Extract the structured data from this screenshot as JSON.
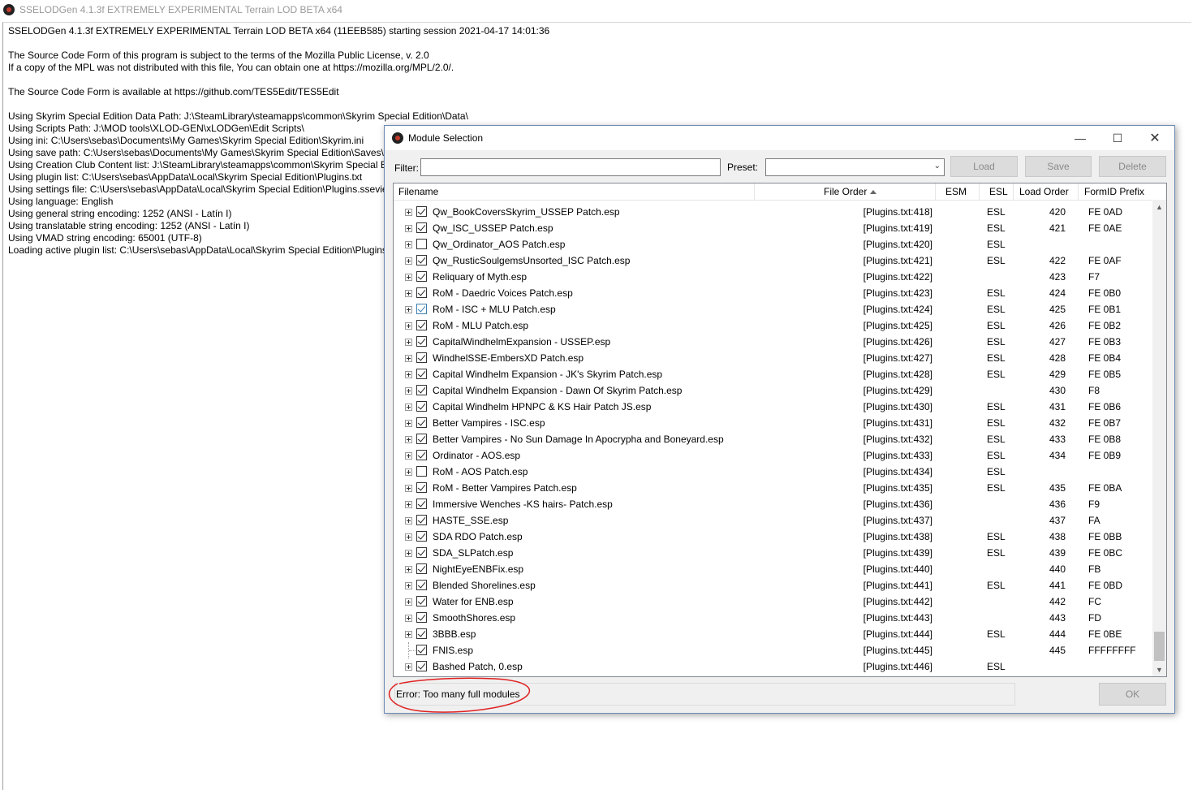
{
  "main": {
    "title": "SSELODGen 4.1.3f EXTREMELY EXPERIMENTAL Terrain LOD BETA x64",
    "log": [
      "SSELODGen 4.1.3f EXTREMELY EXPERIMENTAL Terrain LOD BETA x64 (11EEB585) starting session 2021-04-17 14:01:36",
      "",
      "The Source Code Form of this program is subject to the terms of the Mozilla Public License, v. 2.0",
      "If a copy of the MPL was not distributed with this file, You can obtain one at https://mozilla.org/MPL/2.0/.",
      "",
      "The Source Code Form is available at https://github.com/TES5Edit/TES5Edit",
      "",
      "Using Skyrim Special Edition Data Path: J:\\SteamLibrary\\steamapps\\common\\Skyrim Special Edition\\Data\\",
      "Using Scripts Path: J:\\MOD tools\\XLOD-GEN\\xLODGen\\Edit Scripts\\",
      "Using ini: C:\\Users\\sebas\\Documents\\My Games\\Skyrim Special Edition\\Skyrim.ini",
      "Using save path: C:\\Users\\sebas\\Documents\\My Games\\Skyrim Special Edition\\Saves\\",
      "Using Creation Club Content list: J:\\SteamLibrary\\steamapps\\common\\Skyrim Special E",
      "Using plugin list: C:\\Users\\sebas\\AppData\\Local\\Skyrim Special Edition\\Plugins.txt",
      "Using settings file: C:\\Users\\sebas\\AppData\\Local\\Skyrim Special Edition\\Plugins.ssevie",
      "Using language: English",
      "Using general string encoding: 1252  (ANSI - Latín I)",
      "Using translatable string encoding: 1252  (ANSI - Latín I)",
      "Using VMAD string encoding: 65001 (UTF-8)",
      "Loading active plugin list: C:\\Users\\sebas\\AppData\\Local\\Skyrim Special Edition\\Plugins"
    ]
  },
  "dialog": {
    "title": "Module Selection",
    "filter_label": "Filter:",
    "filter_value": "",
    "preset_label": "Preset:",
    "preset_value": "",
    "load_label": "Load",
    "save_label": "Save",
    "delete_label": "Delete",
    "ok_label": "OK",
    "status": "Error: Too many full modules",
    "columns": {
      "filename": "Filename",
      "file_order": "File Order",
      "esm": "ESM",
      "esl": "ESL",
      "load_order": "Load Order",
      "formid_prefix": "FormID Prefix"
    },
    "annotation_color": "#e02020",
    "rows": [
      {
        "name": "Qw_BookCoversSkyrim_USSEP Patch.esp",
        "order": "[Plugins.txt:418]",
        "esl": "ESL",
        "load": "420",
        "prefix": "FE 0AD",
        "checked": true
      },
      {
        "name": "Qw_ISC_USSEP Patch.esp",
        "order": "[Plugins.txt:419]",
        "esl": "ESL",
        "load": "421",
        "prefix": "FE 0AE",
        "checked": true
      },
      {
        "name": "Qw_Ordinator_AOS Patch.esp",
        "order": "[Plugins.txt:420]",
        "esl": "ESL",
        "load": "",
        "prefix": "",
        "checked": false
      },
      {
        "name": "Qw_RusticSoulgemsUnsorted_ISC Patch.esp",
        "order": "[Plugins.txt:421]",
        "esl": "ESL",
        "load": "422",
        "prefix": "FE 0AF",
        "checked": true
      },
      {
        "name": "Reliquary of Myth.esp",
        "order": "[Plugins.txt:422]",
        "esl": "",
        "load": "423",
        "prefix": "F7",
        "checked": true
      },
      {
        "name": "RoM - Daedric Voices Patch.esp",
        "order": "[Plugins.txt:423]",
        "esl": "ESL",
        "load": "424",
        "prefix": "FE 0B0",
        "checked": true
      },
      {
        "name": "RoM - ISC + MLU Patch.esp",
        "order": "[Plugins.txt:424]",
        "esl": "ESL",
        "load": "425",
        "prefix": "FE 0B1",
        "checked": true,
        "highlight": true
      },
      {
        "name": "RoM - MLU Patch.esp",
        "order": "[Plugins.txt:425]",
        "esl": "ESL",
        "load": "426",
        "prefix": "FE 0B2",
        "checked": true
      },
      {
        "name": "CapitalWindhelmExpansion - USSEP.esp",
        "order": "[Plugins.txt:426]",
        "esl": "ESL",
        "load": "427",
        "prefix": "FE 0B3",
        "checked": true
      },
      {
        "name": "WindhelSSE-EmbersXD Patch.esp",
        "order": "[Plugins.txt:427]",
        "esl": "ESL",
        "load": "428",
        "prefix": "FE 0B4",
        "checked": true
      },
      {
        "name": "Capital Windhelm Expansion - JK's Skyrim Patch.esp",
        "order": "[Plugins.txt:428]",
        "esl": "ESL",
        "load": "429",
        "prefix": "FE 0B5",
        "checked": true
      },
      {
        "name": "Capital Windhelm Expansion - Dawn Of Skyrim Patch.esp",
        "order": "[Plugins.txt:429]",
        "esl": "",
        "load": "430",
        "prefix": "F8",
        "checked": true
      },
      {
        "name": "Capital Windhelm HPNPC & KS Hair Patch JS.esp",
        "order": "[Plugins.txt:430]",
        "esl": "ESL",
        "load": "431",
        "prefix": "FE 0B6",
        "checked": true
      },
      {
        "name": "Better Vampires - ISC.esp",
        "order": "[Plugins.txt:431]",
        "esl": "ESL",
        "load": "432",
        "prefix": "FE 0B7",
        "checked": true
      },
      {
        "name": "Better Vampires - No Sun Damage In Apocrypha and Boneyard.esp",
        "order": "[Plugins.txt:432]",
        "esl": "ESL",
        "load": "433",
        "prefix": "FE 0B8",
        "checked": true
      },
      {
        "name": "Ordinator - AOS.esp",
        "order": "[Plugins.txt:433]",
        "esl": "ESL",
        "load": "434",
        "prefix": "FE 0B9",
        "checked": true
      },
      {
        "name": "RoM - AOS Patch.esp",
        "order": "[Plugins.txt:434]",
        "esl": "ESL",
        "load": "",
        "prefix": "",
        "checked": false
      },
      {
        "name": "RoM - Better Vampires Patch.esp",
        "order": "[Plugins.txt:435]",
        "esl": "ESL",
        "load": "435",
        "prefix": "FE 0BA",
        "checked": true
      },
      {
        "name": "Immersive Wenches -KS hairs- Patch.esp",
        "order": "[Plugins.txt:436]",
        "esl": "",
        "load": "436",
        "prefix": "F9",
        "checked": true
      },
      {
        "name": "HASTE_SSE.esp",
        "order": "[Plugins.txt:437]",
        "esl": "",
        "load": "437",
        "prefix": "FA",
        "checked": true
      },
      {
        "name": "SDA RDO Patch.esp",
        "order": "[Plugins.txt:438]",
        "esl": "ESL",
        "load": "438",
        "prefix": "FE 0BB",
        "checked": true
      },
      {
        "name": "SDA_SLPatch.esp",
        "order": "[Plugins.txt:439]",
        "esl": "ESL",
        "load": "439",
        "prefix": "FE 0BC",
        "checked": true
      },
      {
        "name": "NightEyeENBFix.esp",
        "order": "[Plugins.txt:440]",
        "esl": "",
        "load": "440",
        "prefix": "FB",
        "checked": true
      },
      {
        "name": "Blended Shorelines.esp",
        "order": "[Plugins.txt:441]",
        "esl": "ESL",
        "load": "441",
        "prefix": "FE 0BD",
        "checked": true
      },
      {
        "name": "Water for ENB.esp",
        "order": "[Plugins.txt:442]",
        "esl": "",
        "load": "442",
        "prefix": "FC",
        "checked": true
      },
      {
        "name": "SmoothShores.esp",
        "order": "[Plugins.txt:443]",
        "esl": "",
        "load": "443",
        "prefix": "FD",
        "checked": true
      },
      {
        "name": "3BBB.esp",
        "order": "[Plugins.txt:444]",
        "esl": "ESL",
        "load": "444",
        "prefix": "FE 0BE",
        "checked": true
      },
      {
        "name": "FNIS.esp",
        "order": "[Plugins.txt:445]",
        "esl": "",
        "load": "445",
        "prefix": "FFFFFFFF",
        "checked": true,
        "noexpand": true
      },
      {
        "name": "Bashed Patch, 0.esp",
        "order": "[Plugins.txt:446]",
        "esl": "ESL",
        "load": "",
        "prefix": "",
        "checked": true
      }
    ]
  }
}
